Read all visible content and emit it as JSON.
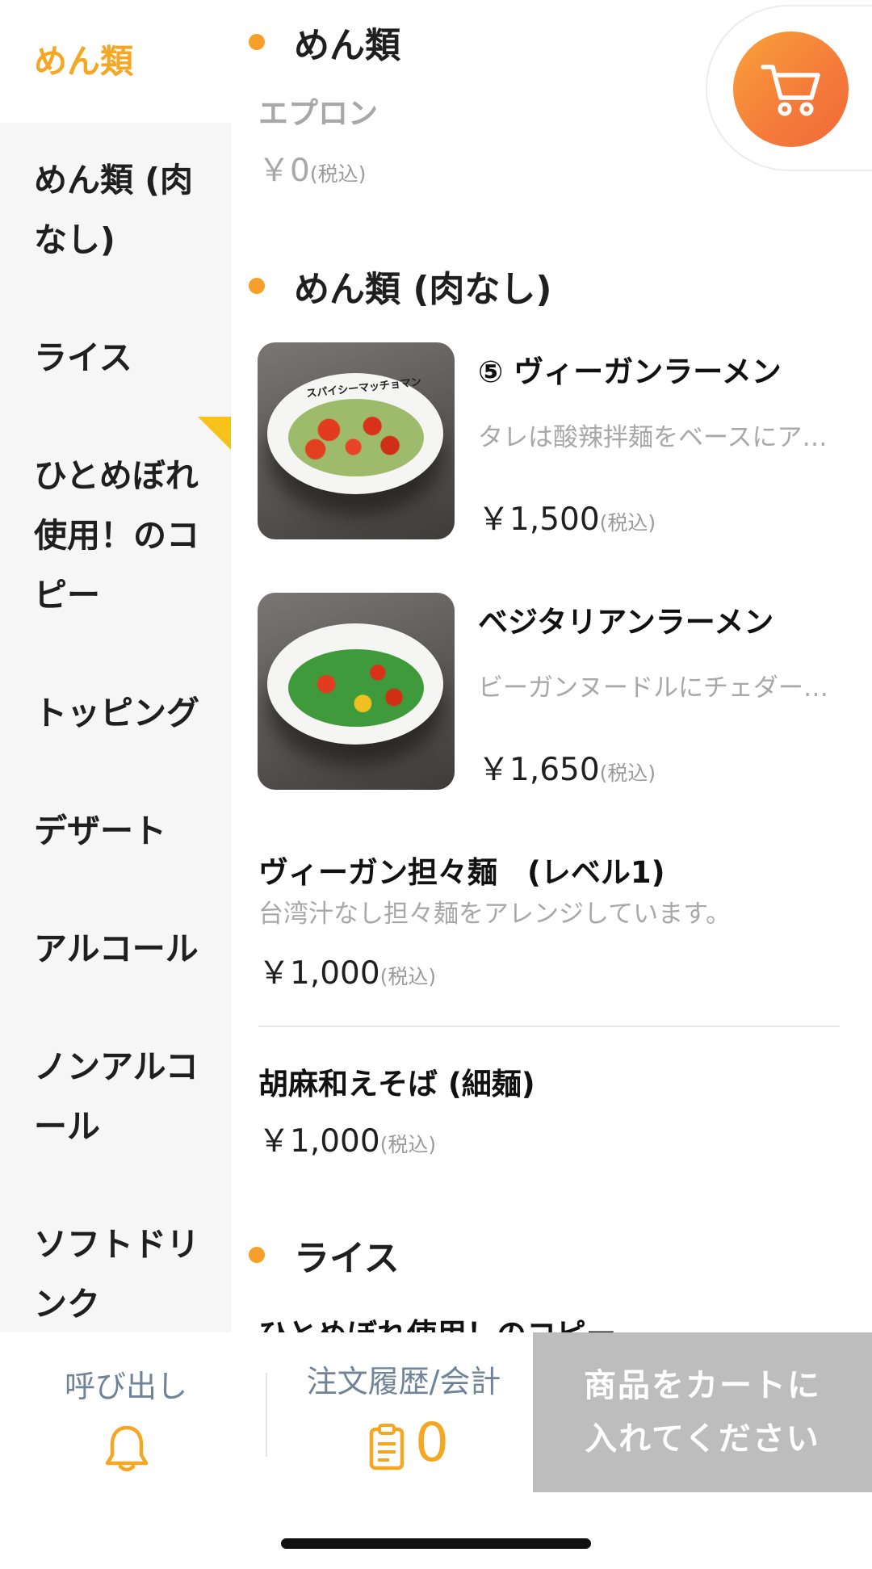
{
  "sidebar": {
    "items": [
      {
        "label": "めん類",
        "active": true
      },
      {
        "label": "めん類 (肉なし)"
      },
      {
        "label": "ライス"
      },
      {
        "label": "ひとめぼれ使用！のコピー"
      },
      {
        "label": "トッピング"
      },
      {
        "label": "デザート"
      },
      {
        "label": "アルコール"
      },
      {
        "label": "ノンアルコール"
      },
      {
        "label": "ソフトドリンク"
      }
    ]
  },
  "sections": {
    "noodles": {
      "title": "めん類",
      "items": [
        {
          "name": "エプロン",
          "price": "￥0",
          "tax": "(税込)"
        }
      ]
    },
    "noodles_nomeat": {
      "title": "めん類 (肉なし)",
      "items": [
        {
          "name": "⑤ ヴィーガンラーメン",
          "desc": "タレは酸辣拌麺をベースにア…",
          "price": "￥1,500",
          "tax": "(税込)",
          "image_text": "スパイシーマッチョマン"
        },
        {
          "name": "ベジタリアンラーメン",
          "desc": "ビーガンヌードルにチェダー…",
          "price": "￥1,650",
          "tax": "(税込)"
        },
        {
          "name": "ヴィーガン担々麺　(レベル1)",
          "desc": "台湾汁なし担々麺をアレンジしています。",
          "price": "￥1,000",
          "tax": "(税込)"
        },
        {
          "name": "胡麻和えそば (細麺)",
          "price": "￥1,000",
          "tax": "(税込)"
        }
      ]
    },
    "rice": {
      "title": "ライス",
      "items": [
        {
          "name": "ひとめぼれ使用！のコピー"
        }
      ]
    }
  },
  "bottombar": {
    "call_label": "呼び出し",
    "history_label": "注文履歴/会計",
    "history_count": "0",
    "cart_cta": "商品をカートに入れてください"
  },
  "colors": {
    "accent": "#f5a623",
    "cart_gradient_start": "#f9a23a",
    "cart_gradient_end": "#f06a3a",
    "disabled_cta": "#bdbdbd"
  },
  "icons": {
    "cart": "cart-icon",
    "call": "bell-icon",
    "history": "clipboard-icon"
  }
}
